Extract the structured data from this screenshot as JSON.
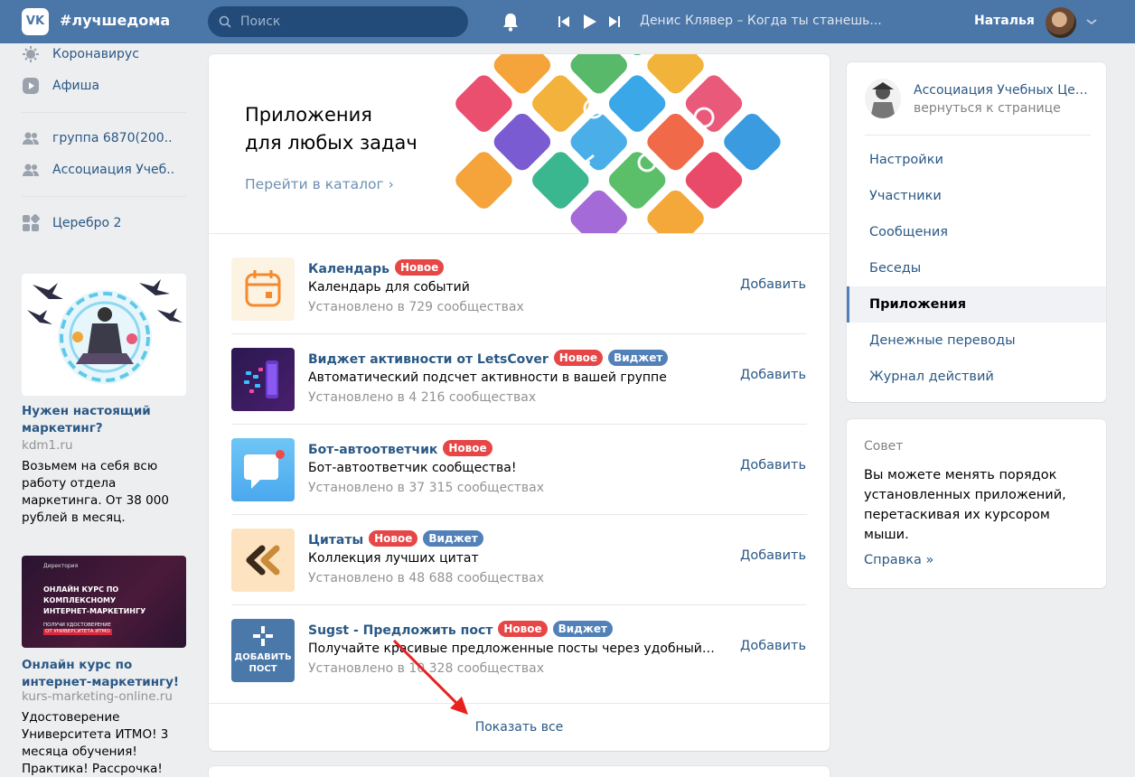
{
  "header": {
    "logo_text": "VK",
    "brand": "#лучшедома",
    "search_placeholder": "Поиск",
    "now_playing": "Денис Клявер – Когда ты станешь...",
    "user_name": "Наталья",
    "colors": {
      "bar": "#4a76a8",
      "search_bg": "#224b7a"
    }
  },
  "left_nav": {
    "items": [
      {
        "label": "Коронавирус",
        "icon": "virus-icon"
      },
      {
        "label": "Афиша",
        "icon": "play-icon"
      },
      {
        "label": "группа 6870(200..",
        "icon": "group-icon"
      },
      {
        "label": "Ассоциация Учеб..",
        "icon": "group-icon"
      },
      {
        "label": "Церебро 2",
        "icon": "apps-icon"
      }
    ]
  },
  "ads": [
    {
      "title": "Нужен настоящий маркетинг?",
      "domain": "kdm1.ru",
      "text": "Возьмем на себя всю работу отдела маркетинга. От 38 000 рублей в месяц."
    },
    {
      "title": "Онлайн курс по интернет-маркетингу!",
      "domain": "kurs-marketing-online.ru",
      "text": "Удостоверение Университета ИТМО! 3 месяца обучения! Практика! Рассрочка!",
      "image_text": {
        "brand": "Директория",
        "line1": "ОНЛАЙН КУРС ПО",
        "line2": "КОМПЛЕКСНОМУ",
        "line3": "ИНТЕРНЕТ-МАРКЕТИНГУ",
        "line4": "ПОЛУЧИ УДОСТОВЕРЕНИЕ",
        "line5": "ОТ УНИВЕРСИТЕТА ИТМО"
      }
    }
  ],
  "banner": {
    "title_line1": "Приложения",
    "title_line2": "для любых задач",
    "link": "Перейти в каталог"
  },
  "apps": [
    {
      "name": "Календарь",
      "badges": [
        "Новое"
      ],
      "widget": false,
      "desc": "Календарь для событий",
      "installed": "Установлено в 729 сообществах",
      "action": "Добавить",
      "icon": "calendar-icon"
    },
    {
      "name": "Виджет активности от LetsCover",
      "badges": [
        "Новое",
        "Виджет"
      ],
      "desc": "Автоматический подсчет активности в вашей группе",
      "installed": "Установлено в 4 216 сообществах",
      "action": "Добавить",
      "icon": "activity-widget-icon"
    },
    {
      "name": "Бот-автоответчик",
      "badges": [
        "Новое"
      ],
      "desc": "Бот-автоответчик сообщества!",
      "installed": "Установлено в 37 315 сообществах",
      "action": "Добавить",
      "icon": "chat-bot-icon"
    },
    {
      "name": "Цитаты",
      "badges": [
        "Новое",
        "Виджет"
      ],
      "desc": "Коллекция лучших цитат",
      "installed": "Установлено в 48 688 сообществах",
      "action": "Добавить",
      "icon": "quotes-icon"
    },
    {
      "name": "Sugst - Предложить пост",
      "badges": [
        "Новое",
        "Виджет"
      ],
      "desc": "Получайте красивые предложенные посты через удобный сервис",
      "installed": "Установлено в 10 328 сообществах",
      "action": "Добавить",
      "icon": "suggest-post-icon",
      "icon_text_1": "ДОБАВИТЬ",
      "icon_text_2": "ПОСТ"
    }
  ],
  "show_all": "Показать все",
  "right_menu": {
    "group_name": "Ассоциация Учебных Центров",
    "back": "вернуться к странице",
    "items": [
      "Настройки",
      "Участники",
      "Сообщения",
      "Беседы",
      "Приложения",
      "Денежные переводы",
      "Журнал действий"
    ],
    "active_index": 4
  },
  "tip": {
    "title": "Совет",
    "text": "Вы можете менять порядок установленных приложений, перетаскивая их курсором мыши.",
    "link": "Справка »"
  }
}
